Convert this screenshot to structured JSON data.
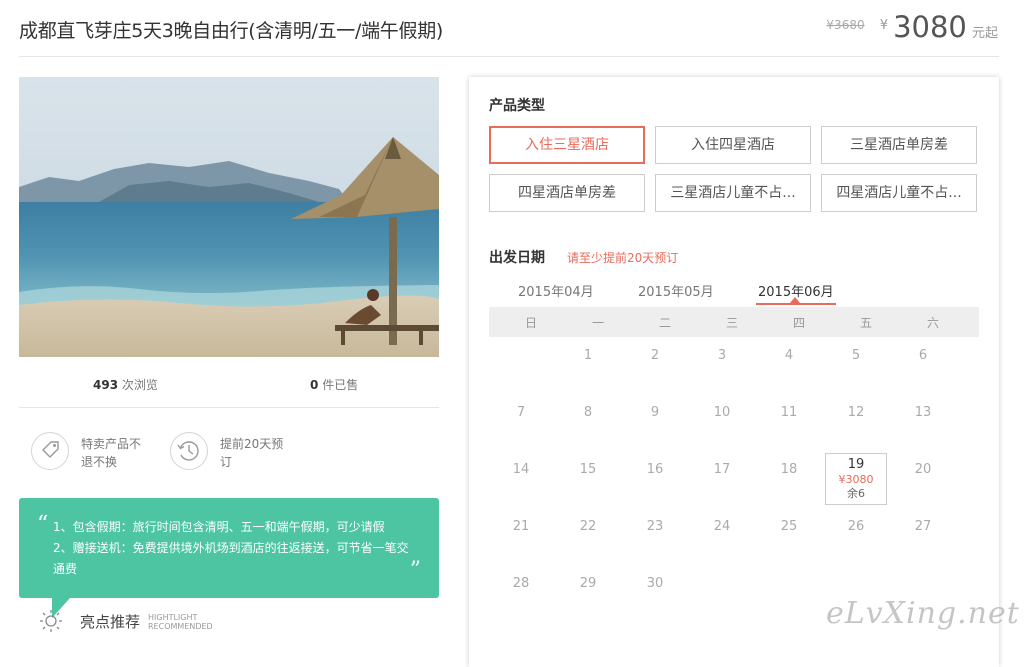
{
  "header": {
    "title": "成都直飞芽庄5天3晚自由行(含清明/五一/端午假期)",
    "old_price": "¥3680",
    "currency": "¥",
    "price": "3080",
    "price_suffix": "元起"
  },
  "stats": {
    "views_count": "493",
    "views_label": "次浏览",
    "sold_count": "0",
    "sold_label": "件已售"
  },
  "features": [
    {
      "icon": "tag-icon",
      "text": "特卖产品不退不换"
    },
    {
      "icon": "clock-icon",
      "text": "提前20天预订"
    }
  ],
  "highlights": {
    "lines": [
      "1、包含假期：旅行时间包含清明、五一和端午假期，可少请假",
      "2、赠接送机：免费提供境外机场到酒店的往返接送，可节省一笔交通费"
    ],
    "label_cn": "亮点推荐",
    "label_en_1": "HIGHTLIGHT",
    "label_en_2": "RECOMMENDED"
  },
  "product_types": {
    "title": "产品类型",
    "options": [
      "入住三星酒店",
      "入住四星酒店",
      "三星酒店单房差",
      "四星酒店单房差",
      "三星酒店儿童不占...",
      "四星酒店儿童不占..."
    ],
    "selected_index": 0
  },
  "departure": {
    "title": "出发日期",
    "note": "请至少提前20天预订",
    "months": [
      "2015年04月",
      "2015年05月",
      "2015年06月"
    ],
    "active_month_index": 2,
    "weekdays": [
      "日",
      "一",
      "二",
      "三",
      "四",
      "五",
      "六"
    ],
    "available_day": {
      "day": "19",
      "price": "¥3080",
      "remain": "余6"
    }
  },
  "watermark": "eLvXing.net",
  "colors": {
    "accent": "#e86b5c",
    "highlight_bg": "#4dc4a2"
  }
}
